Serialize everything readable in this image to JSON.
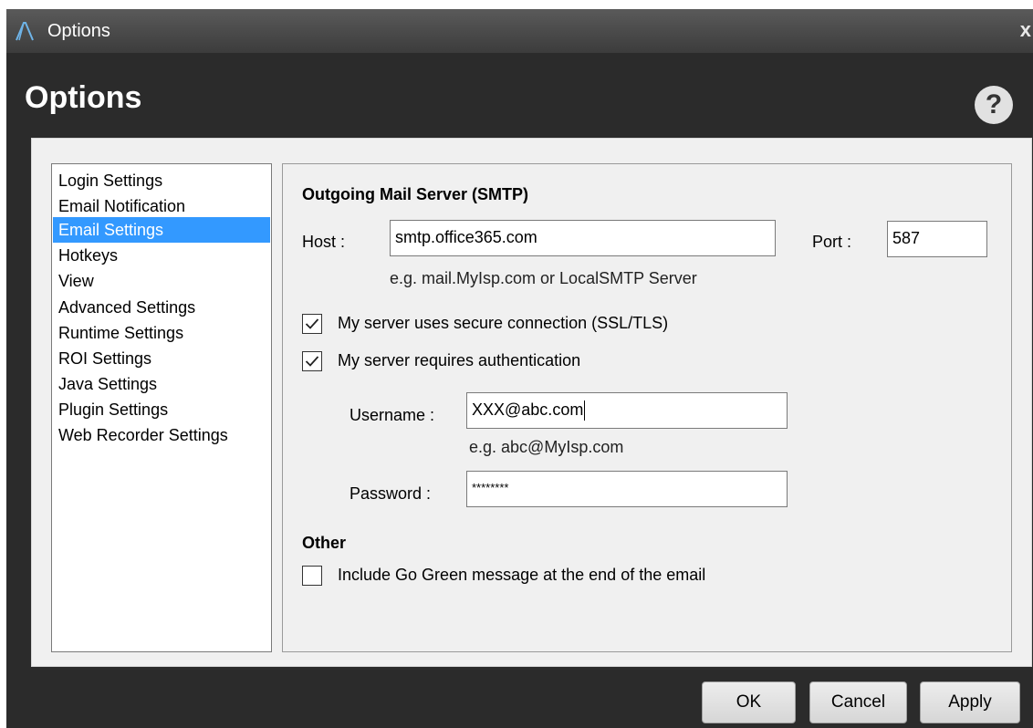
{
  "window": {
    "title": "Options",
    "close_glyph": "x",
    "header_title": "Options",
    "help_glyph": "?"
  },
  "nav": {
    "items": [
      {
        "label": "Login Settings"
      },
      {
        "label": "Email Notification"
      },
      {
        "label": "Email Settings",
        "selected": true
      },
      {
        "label": "Hotkeys"
      },
      {
        "label": "View"
      },
      {
        "label": "Advanced Settings"
      },
      {
        "label": "Runtime Settings"
      },
      {
        "label": "ROI Settings"
      },
      {
        "label": "Java Settings"
      },
      {
        "label": "Plugin Settings"
      },
      {
        "label": "Web Recorder Settings"
      }
    ]
  },
  "smtp": {
    "heading": "Outgoing Mail Server (SMTP)",
    "host_label": "Host :",
    "host_value": "smtp.office365.com",
    "host_hint": "e.g. mail.MyIsp.com or LocalSMTP Server",
    "port_label": "Port :",
    "port_value": "587",
    "ssl_label": "My server uses secure connection (SSL/TLS)",
    "ssl_checked": true,
    "auth_label": "My server requires authentication",
    "auth_checked": true,
    "username_label": "Username :",
    "username_value": "XXX@abc.com",
    "username_hint": "e.g. abc@MyIsp.com",
    "password_label": "Password :",
    "password_value": "********"
  },
  "other": {
    "heading": "Other",
    "go_green_label": "Include Go Green message at the end of the email",
    "go_green_checked": false
  },
  "buttons": {
    "ok": "OK",
    "cancel": "Cancel",
    "apply": "Apply"
  },
  "colors": {
    "selection": "#3399ff",
    "dialog_background": "#2b2b2b",
    "panel_background": "#f0f0f0"
  },
  "icons": {
    "logo": "app-logo-a",
    "help": "question-mark-icon",
    "close": "close-icon",
    "check": "checkmark-icon"
  }
}
